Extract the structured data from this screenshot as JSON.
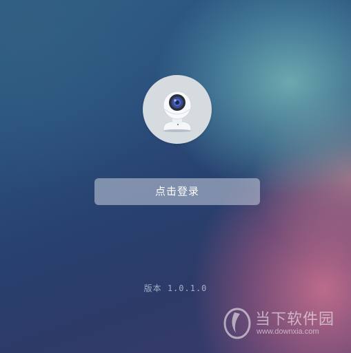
{
  "login": {
    "button_label": "点击登录"
  },
  "footer": {
    "version_text": "版本 1.0.1.0"
  },
  "watermark": {
    "title": "当下软件园",
    "url": "www.downxia.com"
  },
  "icons": {
    "avatar": "camera-icon",
    "watermark_logo": "downxia-logo-icon"
  },
  "colors": {
    "avatar_bg": "#d6dbe0",
    "button_bg": "#c8d0de",
    "button_text": "#ffffff"
  }
}
